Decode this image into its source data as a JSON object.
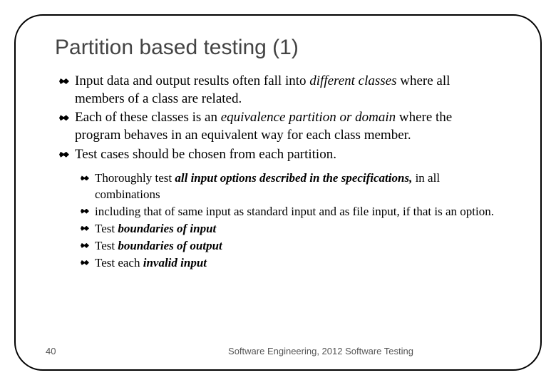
{
  "title": "Partition based testing (1)",
  "bullets": {
    "b1_prefix": "Input data and output results often fall into ",
    "b1_em": "different classes",
    "b1_suffix": " where all members of a class are related.",
    "b2_prefix": "Each of these classes is an ",
    "b2_em": "equivalence partition or domain",
    "b2_suffix": " where the program behaves in an equivalent way for each class member.",
    "b3": "Test cases should be chosen from each partition."
  },
  "sub_bullets": {
    "s1_prefix": "Thoroughly test ",
    "s1_em": "all input options described in the specifications,",
    "s1_suffix": " in all combinations",
    "s2": "including that of same input as standard input and as file input, if that is an option.",
    "s3_prefix": "Test ",
    "s3_em": "boundaries of input",
    "s4_prefix": "Test ",
    "s4_em": "boundaries of output",
    "s5_prefix": "Test each ",
    "s5_em": "invalid input"
  },
  "page_number": "40",
  "footer": "Software Engineering,  2012 Software Testing"
}
